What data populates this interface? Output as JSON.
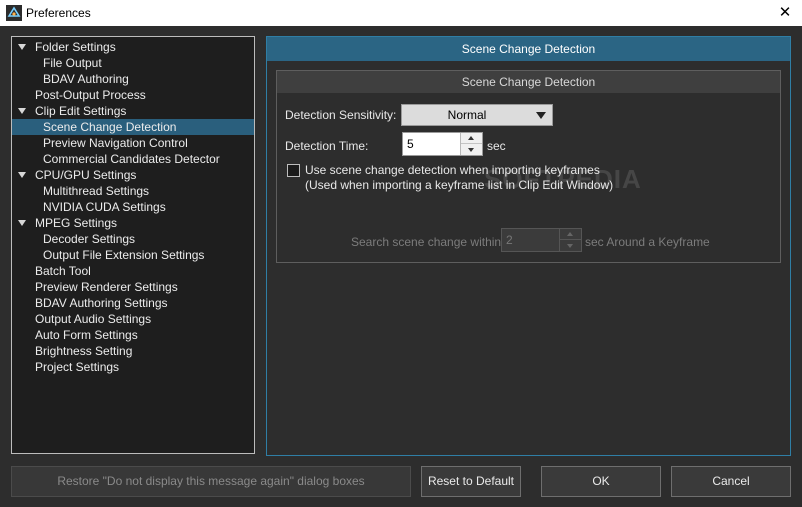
{
  "window": {
    "title": "Preferences",
    "close_glyph": "✕"
  },
  "tree": {
    "items": [
      {
        "label": "Folder Settings",
        "level": 0,
        "expanded": true,
        "selected": false
      },
      {
        "label": "File Output",
        "level": 1,
        "selected": false
      },
      {
        "label": "BDAV Authoring",
        "level": 1,
        "selected": false
      },
      {
        "label": "Post-Output Process",
        "level": 0,
        "selected": false
      },
      {
        "label": "Clip Edit Settings",
        "level": 0,
        "expanded": true,
        "selected": false
      },
      {
        "label": "Scene Change Detection",
        "level": 1,
        "selected": true
      },
      {
        "label": "Preview Navigation Control",
        "level": 1,
        "selected": false
      },
      {
        "label": "Commercial Candidates Detector",
        "level": 1,
        "selected": false
      },
      {
        "label": "CPU/GPU Settings",
        "level": 0,
        "expanded": true,
        "selected": false
      },
      {
        "label": "Multithread Settings",
        "level": 1,
        "selected": false
      },
      {
        "label": "NVIDIA CUDA Settings",
        "level": 1,
        "selected": false
      },
      {
        "label": "MPEG Settings",
        "level": 0,
        "expanded": true,
        "selected": false
      },
      {
        "label": "Decoder Settings",
        "level": 1,
        "selected": false
      },
      {
        "label": "Output File Extension Settings",
        "level": 1,
        "selected": false
      },
      {
        "label": "Batch Tool",
        "level": 0,
        "selected": false
      },
      {
        "label": "Preview Renderer Settings",
        "level": 0,
        "selected": false
      },
      {
        "label": "BDAV Authoring Settings",
        "level": 0,
        "selected": false
      },
      {
        "label": "Output Audio Settings",
        "level": 0,
        "selected": false
      },
      {
        "label": "Auto Form Settings",
        "level": 0,
        "selected": false
      },
      {
        "label": "Brightness Setting",
        "level": 0,
        "selected": false
      },
      {
        "label": "Project Settings",
        "level": 0,
        "selected": false
      }
    ]
  },
  "panel": {
    "header": "Scene Change Detection",
    "group_title": "Scene Change Detection",
    "sensitivity": {
      "label": "Detection Sensitivity:",
      "value": "Normal"
    },
    "time": {
      "label": "Detection Time:",
      "value": "5",
      "unit": "sec"
    },
    "keyframe_checkbox": {
      "checked": false,
      "line1": "Use scene change detection when importing keyframes",
      "line2": "(Used when importing a keyframe list in Clip Edit Window)"
    },
    "search": {
      "prefix": "Search scene change within",
      "value": "2",
      "suffix": "sec Around a Keyframe"
    }
  },
  "watermark": "SOFTPEDIA",
  "buttons": {
    "restore": "Restore \"Do not display this message again\" dialog boxes",
    "reset": "Reset to Default",
    "ok": "OK",
    "cancel": "Cancel"
  },
  "colors": {
    "accent": "#2b6584",
    "selection": "#2a5f7d",
    "background": "#2d2d2d"
  }
}
